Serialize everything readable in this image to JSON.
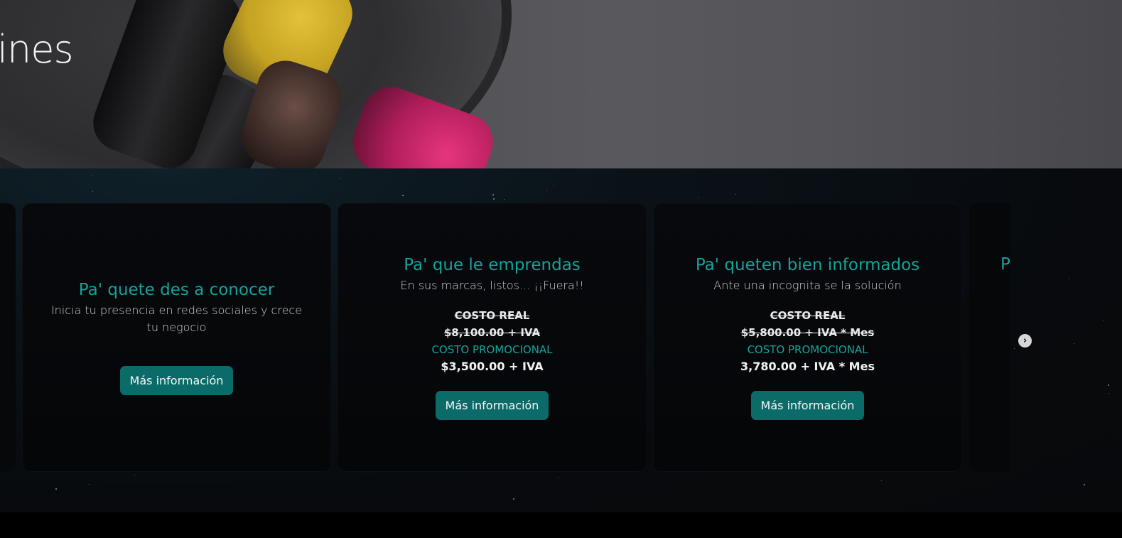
{
  "hero": {
    "title_fragment": "ines"
  },
  "services": {
    "cards": [
      {
        "title": "Pa' quete des a conocer",
        "subtitle": "Inicia tu presencia en redes sociales y crece tu negocio",
        "button": "Más información"
      },
      {
        "title": "Pa' que le emprendas",
        "subtitle": "En sus marcas, listos... ¡¡Fuera!!",
        "real_label": "COSTO REAL",
        "real_price": "$8,100.00 + IVA",
        "promo_label": "COSTO PROMOCIONAL",
        "promo_price": "$3,500.00 + IVA",
        "button": "Más información"
      },
      {
        "title": "Pa' queten bien informados",
        "subtitle": "Ante una incognita se la solución",
        "real_label": "COSTO REAL",
        "real_price": "$5,800.00 + IVA * Mes",
        "promo_label": "COSTO PROMOCIONAL",
        "promo_price": "3,780.00 + IVA * Mes",
        "button": "Más información"
      }
    ],
    "next_card_peek": "P",
    "next_arrow_icon": "chevron-right-circle-icon",
    "colors": {
      "accent": "#14a39a",
      "button_bg": "#0b6b69"
    }
  }
}
